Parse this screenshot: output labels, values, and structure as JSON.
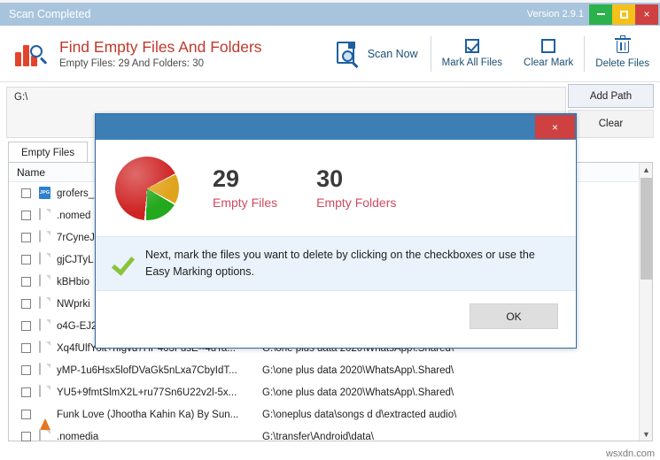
{
  "background": {
    "ghost_text": "......   ........   .........   ........"
  },
  "window": {
    "title": "Scan Completed",
    "version": "Version 2.9.1",
    "buttons": {
      "minimize": "minimize-icon",
      "maximize": "maximize-icon",
      "close": "×"
    }
  },
  "header": {
    "app_title": "Find Empty Files And Folders",
    "app_subtitle": "Empty Files: 29 And Folders: 30",
    "logo_icon": "bar-chart-magnifier-icon",
    "tools": [
      {
        "label": "Scan Now",
        "icon": "scan-document-icon"
      },
      {
        "label": "Mark All Files",
        "icon": "checked-checkbox-icon"
      },
      {
        "label": "Clear Mark",
        "icon": "empty-checkbox-icon"
      },
      {
        "label": "Delete Files",
        "icon": "trash-icon"
      }
    ]
  },
  "path": {
    "value": "G:\\",
    "placeholder": "",
    "add_label": "Add Path",
    "clear_label": "Clear"
  },
  "tabs": [
    {
      "label": "Empty Files",
      "active": true
    }
  ],
  "list": {
    "columns": [
      "Name",
      "",
      ""
    ],
    "rows": [
      {
        "icon": "jpg-file-icon",
        "name": "grofers_",
        "path": ""
      },
      {
        "icon": "doc-file-icon",
        "name": ".nomed",
        "path": ""
      },
      {
        "icon": "doc-file-icon",
        "name": "7rCyneJ",
        "path": ""
      },
      {
        "icon": "doc-file-icon",
        "name": "gjCJTyL",
        "path": ""
      },
      {
        "icon": "doc-file-icon",
        "name": "kBHbio",
        "path": ""
      },
      {
        "icon": "doc-file-icon",
        "name": "NWprki",
        "path": ""
      },
      {
        "icon": "doc-file-icon",
        "name": "o4G-EJ2",
        "path": ""
      },
      {
        "icon": "doc-file-icon",
        "name": "Xq4fUlfYolt+hIgvd7HP403FusE--4uTa...",
        "path": "G:\\one plus data 2020\\WhatsApp\\.Shared\\"
      },
      {
        "icon": "doc-file-icon",
        "name": "yMP-1u6Hsx5lofDVaGk5nLxa7CbyIdT...",
        "path": "G:\\one plus data 2020\\WhatsApp\\.Shared\\"
      },
      {
        "icon": "doc-file-icon",
        "name": "YU5+9fmtSlmX2L+ru77Sn6U22v2l-5x...",
        "path": "G:\\one plus data 2020\\WhatsApp\\.Shared\\"
      },
      {
        "icon": "vlc-file-icon",
        "name": "Funk Love (Jhootha Kahin Ka) By Sun...",
        "path": "G:\\oneplus data\\songs d d\\extracted audio\\"
      },
      {
        "icon": "doc-file-icon",
        "name": ".nomedia",
        "path": "G:\\transfer\\Android\\data\\"
      }
    ],
    "scrollbar": {
      "up": "▲",
      "down": "▼"
    }
  },
  "dialog": {
    "close_label": "×",
    "empty_files_count": "29",
    "empty_files_label": "Empty Files",
    "empty_folders_count": "30",
    "empty_folders_label": "Empty Folders",
    "pie_icon": "pie-chart-icon",
    "check_icon": "green-check-icon",
    "message": "Next, mark the files you want to delete by clicking on the checkboxes or use the Easy Marking options.",
    "ok_label": "OK"
  },
  "watermark": "wsxdn.com",
  "colors": {
    "titlebar": "#a8c4dd",
    "brand_red": "#c0392b",
    "tool_blue": "#1f5fa0",
    "dialog_blue": "#3d7fb5",
    "close_red": "#cf4040",
    "min_green": "#2bb24c",
    "max_yellow": "#f4c01a",
    "accent_pink": "#d04a5e",
    "pie_red": "#cf2222",
    "pie_yellow": "#e0a41c",
    "pie_green": "#23a81e"
  }
}
